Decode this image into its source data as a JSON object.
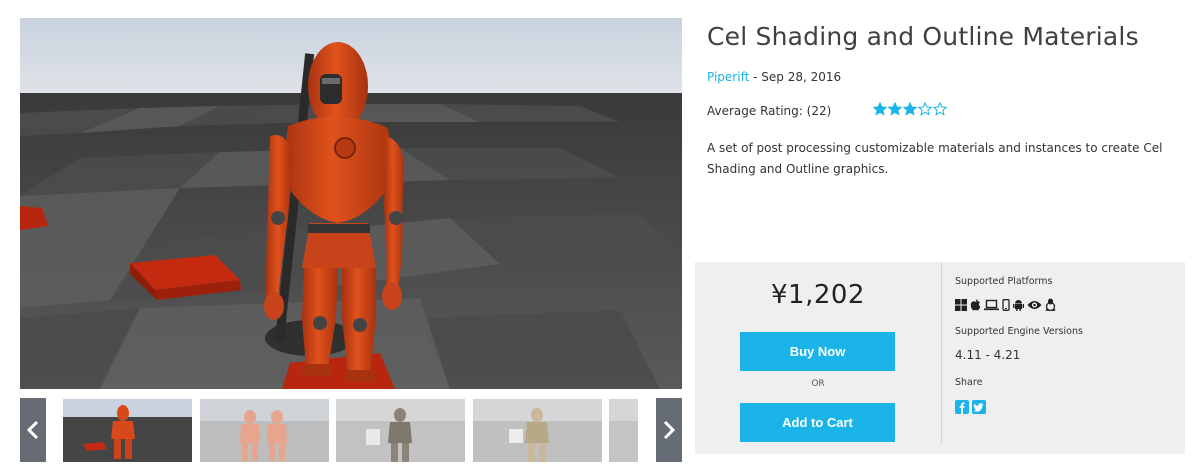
{
  "product": {
    "title": "Cel Shading and Outline Materials",
    "seller": "Piperift",
    "date_separator": " - ",
    "date": "Sep 28, 2016",
    "rating_label": "Average Rating: (22)",
    "rating": 3,
    "rating_max": 5,
    "description": "A set of post processing customizable materials and instances to create Cel Shading and Outline graphics."
  },
  "gallery": {
    "main_image": "orange-robot-character-on-checkered-floor",
    "prev_icon": "chevron-left-icon",
    "next_icon": "chevron-right-icon",
    "thumbnails": [
      {
        "name": "thumb-orange-robot",
        "selected": true
      },
      {
        "name": "thumb-two-robots-faded",
        "selected": false
      },
      {
        "name": "thumb-dark-robot-faded",
        "selected": false
      },
      {
        "name": "thumb-camo-robot-faded",
        "selected": false
      },
      {
        "name": "thumb-partial-faded",
        "selected": false
      }
    ]
  },
  "purchase": {
    "price": "¥1,202",
    "buy_now": "Buy Now",
    "or": "OR",
    "add_to_cart": "Add to Cart",
    "supported_platforms_label": "Supported Platforms",
    "platforms": [
      "windows-icon",
      "apple-icon",
      "laptop-icon",
      "mobile-icon",
      "android-icon",
      "eye-icon",
      "linux-icon"
    ],
    "engine_versions_label": "Supported Engine Versions",
    "engine_versions": "4.11 - 4.21",
    "share_label": "Share",
    "share": [
      "facebook-icon",
      "twitter-icon"
    ]
  },
  "colors": {
    "accent": "#1ab4e8",
    "panel_bg": "#efefef",
    "star": "#1ab4e8"
  }
}
